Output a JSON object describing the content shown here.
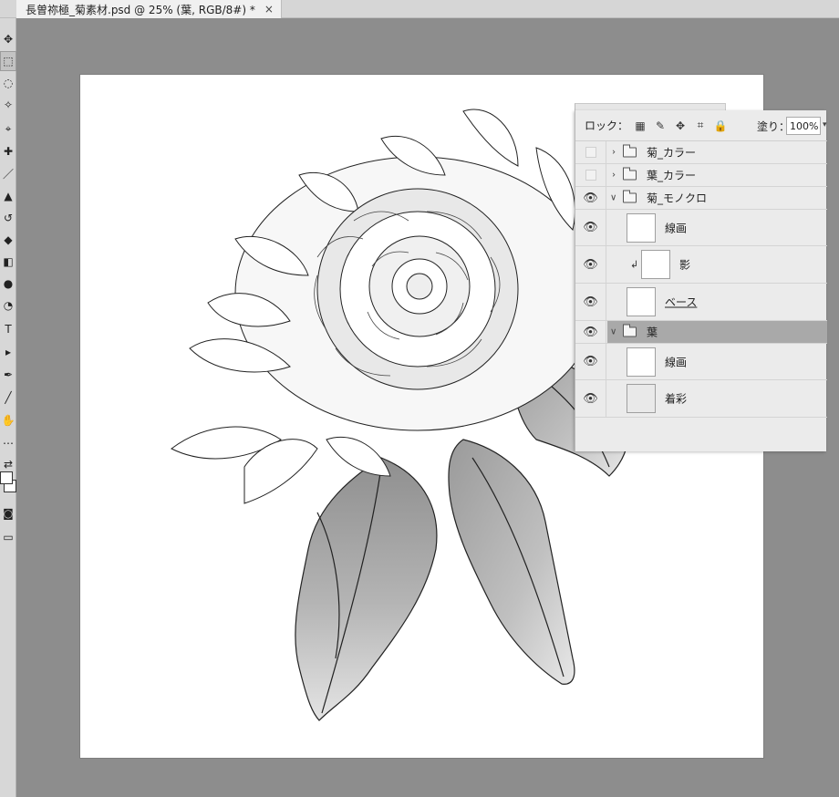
{
  "document_tab": {
    "title": "長曽祢極_菊素材.psd @ 25% (葉, RGB/8#) *",
    "close_glyph": "×"
  },
  "toolbar": {
    "tools": [
      {
        "icon": "move-icon",
        "glyph": "✥"
      },
      {
        "icon": "marquee-icon",
        "glyph": "⬚"
      },
      {
        "icon": "lasso-icon",
        "glyph": "◌"
      },
      {
        "icon": "magic-wand-icon",
        "glyph": "✧"
      },
      {
        "icon": "eyedropper-icon",
        "glyph": "⌖"
      },
      {
        "icon": "healing-icon",
        "glyph": "✚"
      },
      {
        "icon": "brush-icon",
        "glyph": "／"
      },
      {
        "icon": "stamp-icon",
        "glyph": "▲"
      },
      {
        "icon": "history-brush-icon",
        "glyph": "↺"
      },
      {
        "icon": "eraser-icon",
        "glyph": "◆"
      },
      {
        "icon": "paint-bucket-icon",
        "glyph": "◧"
      },
      {
        "icon": "blur-icon",
        "glyph": "●"
      },
      {
        "icon": "dodge-icon",
        "glyph": "◔"
      },
      {
        "icon": "type-icon",
        "glyph": "T"
      },
      {
        "icon": "path-select-icon",
        "glyph": "▸"
      },
      {
        "icon": "pen-icon",
        "glyph": "✒"
      },
      {
        "icon": "shape-icon",
        "glyph": "╱"
      },
      {
        "icon": "hand-icon",
        "glyph": "✋"
      },
      {
        "icon": "more-tools-icon",
        "glyph": "⋯"
      },
      {
        "icon": "swap-colors-icon",
        "glyph": "⇄"
      }
    ],
    "bottom_tools": [
      {
        "icon": "quick-mask-icon",
        "glyph": "◙"
      },
      {
        "icon": "screen-mode-icon",
        "glyph": "▭"
      }
    ]
  },
  "layers_panel": {
    "lock_label": "ロック：",
    "lock_icons": [
      {
        "icon": "lock-transparency-icon",
        "glyph": "▦"
      },
      {
        "icon": "lock-paint-icon",
        "glyph": "✎"
      },
      {
        "icon": "lock-position-icon",
        "glyph": "✥"
      },
      {
        "icon": "lock-artboard-icon",
        "glyph": "⌗"
      },
      {
        "icon": "lock-all-icon",
        "glyph": "🔒"
      }
    ],
    "fill_label": "塗り：",
    "fill_value": "100%",
    "eye_glyph": "👁",
    "twirl_closed": "›",
    "twirl_open": "∨",
    "clip_glyph": "↲",
    "layers": [
      {
        "name": "菊_カラー",
        "type": "group",
        "visible": false,
        "expanded": false
      },
      {
        "name": "葉_カラー",
        "type": "group",
        "visible": false,
        "expanded": false
      },
      {
        "name": "菊_モノクロ",
        "type": "group",
        "visible": true,
        "expanded": true
      },
      {
        "name": "線画",
        "type": "layer",
        "visible": true
      },
      {
        "name": "影",
        "type": "layer",
        "visible": true,
        "clipped": true
      },
      {
        "name": "ベース",
        "type": "layer",
        "visible": true
      },
      {
        "name": "葉",
        "type": "group",
        "visible": true,
        "expanded": true,
        "selected": true
      },
      {
        "name": "線画",
        "type": "layer",
        "visible": true
      },
      {
        "name": "着彩",
        "type": "layer",
        "visible": true
      }
    ]
  },
  "colors": {
    "workspace": "#8d8d8d",
    "selected_row": "#a9a9a9",
    "panel": "#ebebeb"
  }
}
